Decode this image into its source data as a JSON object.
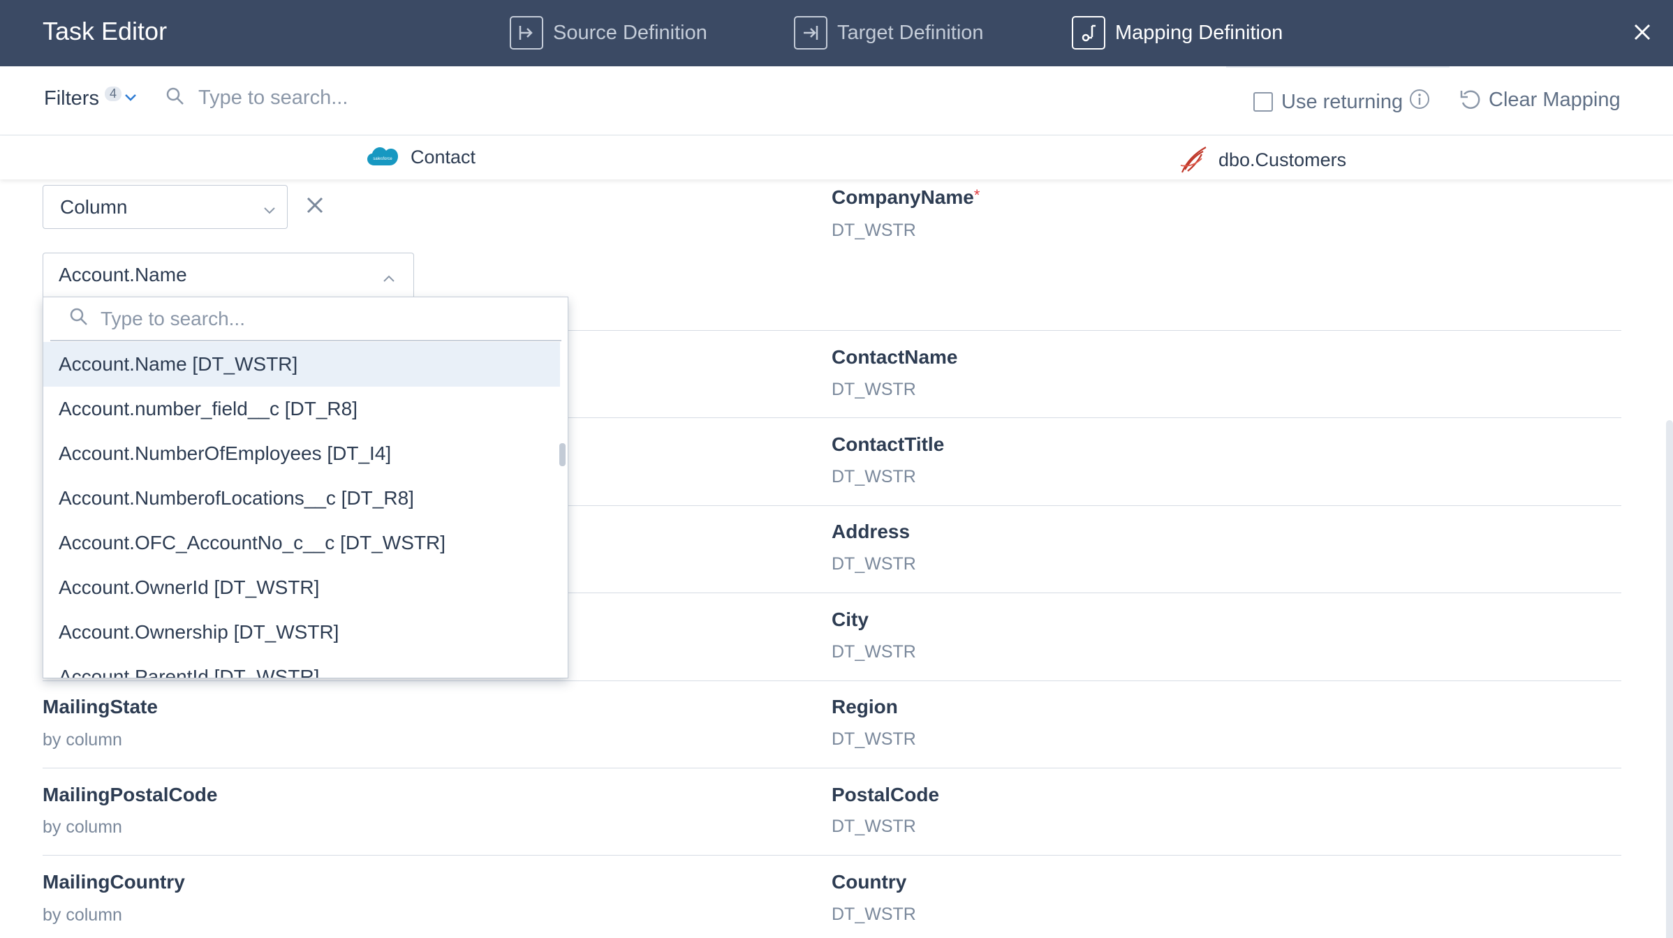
{
  "header": {
    "title": "Task Editor",
    "tabs": [
      {
        "label": "Source Definition",
        "icon": "source-definition-icon",
        "active": false
      },
      {
        "label": "Target Definition",
        "icon": "target-definition-icon",
        "active": false
      },
      {
        "label": "Mapping Definition",
        "icon": "mapping-definition-icon",
        "active": true
      }
    ],
    "close_icon": "close-icon"
  },
  "toolbar": {
    "filters_label": "Filters",
    "filters_count": "4",
    "search_placeholder": "Type to search...",
    "use_returning_label": "Use returning",
    "use_returning_checked": false,
    "clear_mapping_label": "Clear Mapping"
  },
  "objects": {
    "source": {
      "label": "Contact",
      "icon": "salesforce-icon"
    },
    "target": {
      "label": "dbo.Customers",
      "icon": "sql-server-icon"
    }
  },
  "mapping": {
    "first": {
      "type_select": "Column",
      "column_select": "Account.Name",
      "target_name": "CompanyName",
      "target_required": "*",
      "target_type": "DT_WSTR"
    },
    "rows": [
      {
        "source": "",
        "source_sub": "",
        "target": "ContactName",
        "type": "DT_WSTR"
      },
      {
        "source": "",
        "source_sub": "",
        "target": "ContactTitle",
        "type": "DT_WSTR"
      },
      {
        "source": "",
        "source_sub": "",
        "target": "Address",
        "type": "DT_WSTR"
      },
      {
        "source": "",
        "source_sub": "",
        "target": "City",
        "type": "DT_WSTR"
      },
      {
        "source": "MailingState",
        "source_sub": "by column",
        "target": "Region",
        "type": "DT_WSTR"
      },
      {
        "source": "MailingPostalCode",
        "source_sub": "by column",
        "target": "PostalCode",
        "type": "DT_WSTR"
      },
      {
        "source": "MailingCountry",
        "source_sub": "by column",
        "target": "Country",
        "type": "DT_WSTR"
      }
    ]
  },
  "dropdown": {
    "search_placeholder": "Type to search...",
    "items": [
      "Account.Name [DT_WSTR]",
      "Account.number_field__c [DT_R8]",
      "Account.NumberOfEmployees [DT_I4]",
      "Account.NumberofLocations__c [DT_R8]",
      "Account.OFC_AccountNo_c__c [DT_WSTR]",
      "Account.OwnerId [DT_WSTR]",
      "Account.Ownership [DT_WSTR]",
      "Account.ParentId [DT_WSTR]"
    ],
    "selected_index": 0
  },
  "colors": {
    "header_bg": "#3b4a64",
    "text": "#2d3c52",
    "muted": "#7a889b",
    "required": "#e0393e",
    "selected_bg": "#e9f0f8",
    "salesforce_blue": "#1798c1",
    "sql_red": "#c0392b"
  }
}
